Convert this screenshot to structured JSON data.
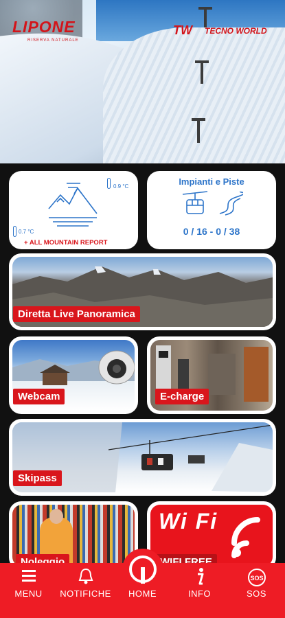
{
  "hero": {
    "brand_left": "LIPONE",
    "brand_left_sub": "RISERVA NATURALE",
    "brand_right_mark": "TW",
    "brand_right": "TECNO WORLD"
  },
  "weather": {
    "temp_top": "0.9 °C",
    "temp_bottom": "0.7 °C",
    "report_link": "+ ALL MOUNTAIN REPORT"
  },
  "impianti": {
    "title": "Impianti e Piste",
    "count": "0 / 16 - 0 / 38"
  },
  "tiles": {
    "panoramica": "Diretta Live Panoramica",
    "webcam": "Webcam",
    "echarge": "E-charge",
    "skipass": "Skipass",
    "noleggio": "Noleggio",
    "wifi_logo": "Wi Fi",
    "wifi": "WIFI FREE"
  },
  "nav": {
    "menu": "MENU",
    "notifiche": "NOTIFICHE",
    "home": "HOME",
    "info": "INFO",
    "sos": "SOS",
    "sos_badge": "SOS"
  },
  "colors": {
    "accent_red": "#ee1c25",
    "link_blue": "#2c74c9"
  }
}
